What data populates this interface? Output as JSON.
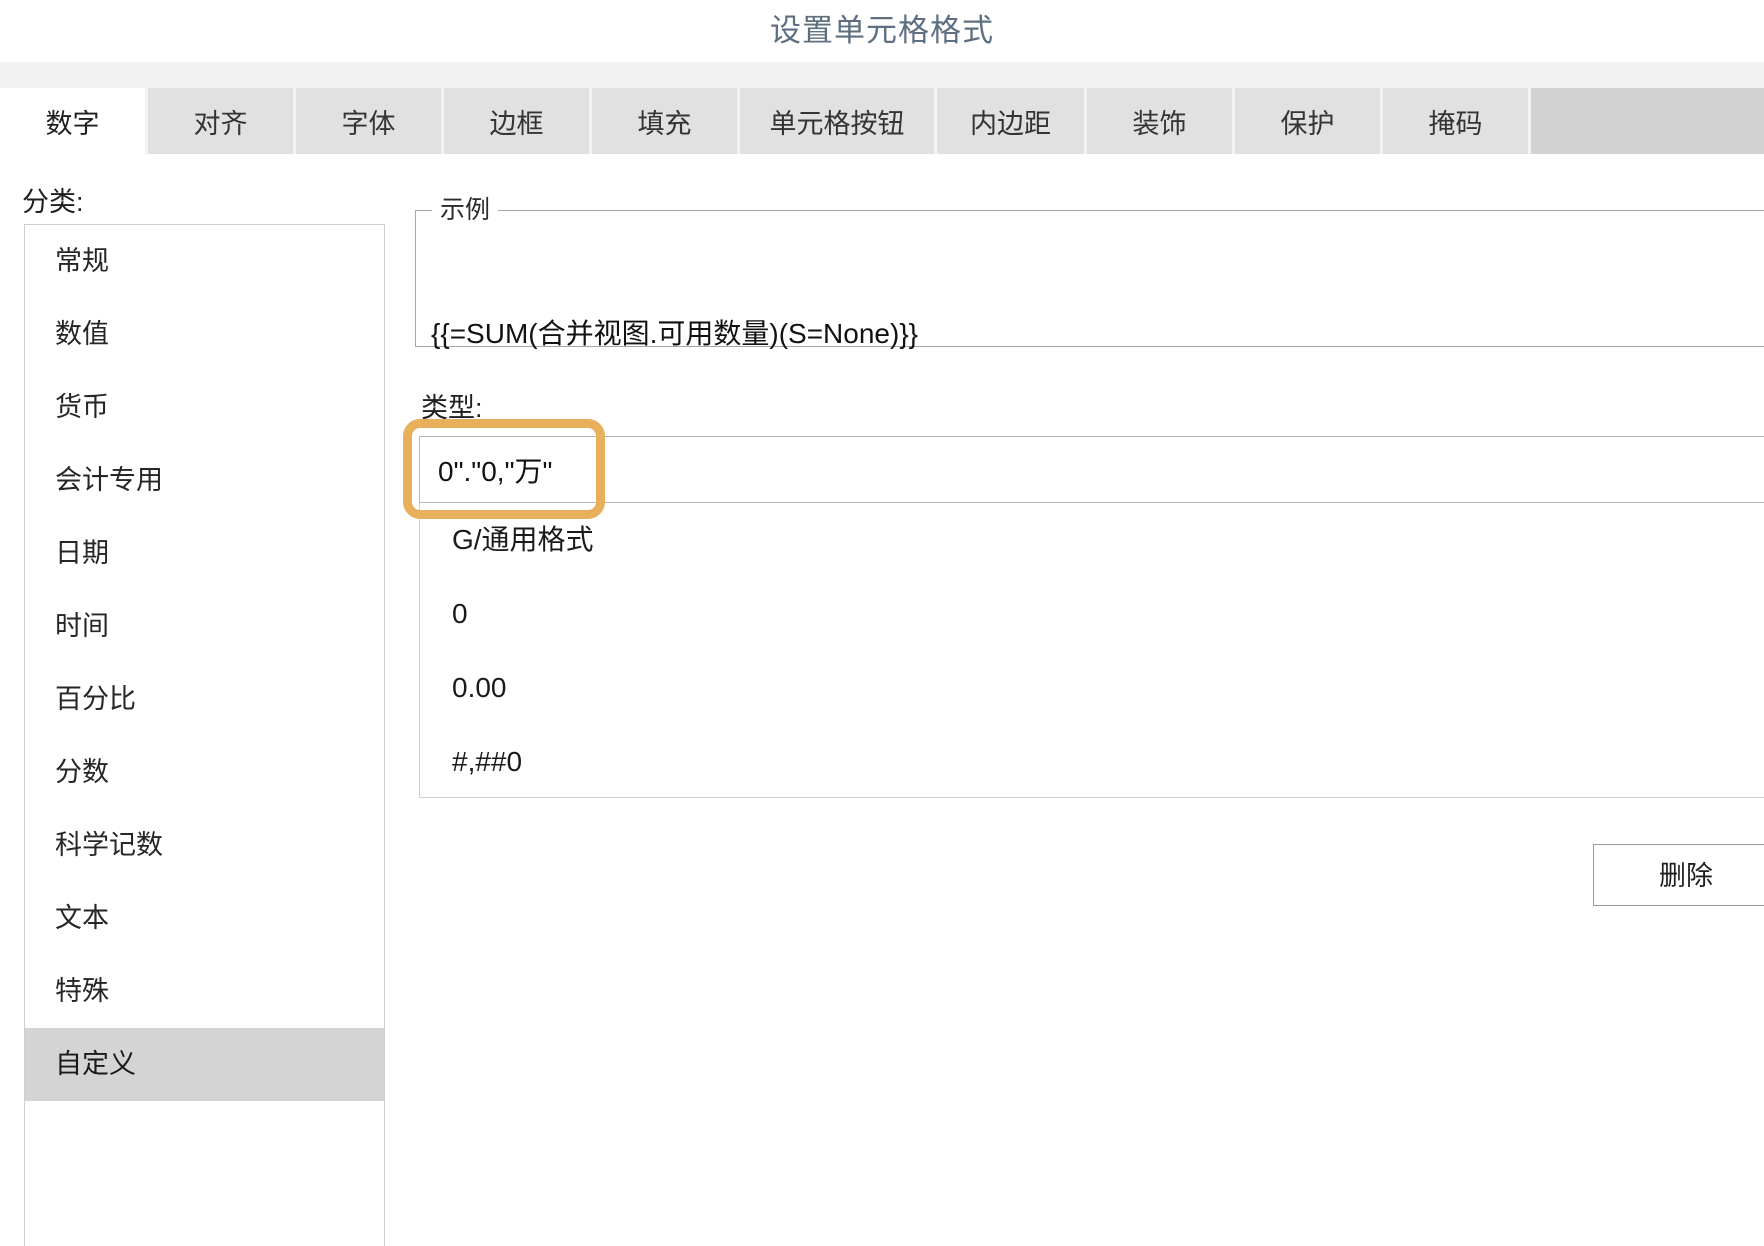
{
  "dialog": {
    "title": "设置单元格格式",
    "title_color": "#5d6f80"
  },
  "tabs": [
    {
      "label": "数字",
      "active": true
    },
    {
      "label": "对齐",
      "active": false
    },
    {
      "label": "字体",
      "active": false
    },
    {
      "label": "边框",
      "active": false
    },
    {
      "label": "填充",
      "active": false
    },
    {
      "label": "单元格按钮",
      "active": false
    },
    {
      "label": "内边距",
      "active": false
    },
    {
      "label": "装饰",
      "active": false
    },
    {
      "label": "保护",
      "active": false
    },
    {
      "label": "掩码",
      "active": false
    }
  ],
  "category": {
    "label": "分类:",
    "items": [
      {
        "label": "常规",
        "selected": false
      },
      {
        "label": "数值",
        "selected": false
      },
      {
        "label": "货币",
        "selected": false
      },
      {
        "label": "会计专用",
        "selected": false
      },
      {
        "label": "日期",
        "selected": false
      },
      {
        "label": "时间",
        "selected": false
      },
      {
        "label": "百分比",
        "selected": false
      },
      {
        "label": "分数",
        "selected": false
      },
      {
        "label": "科学记数",
        "selected": false
      },
      {
        "label": "文本",
        "selected": false
      },
      {
        "label": "特殊",
        "selected": false
      },
      {
        "label": "自定义",
        "selected": true
      }
    ]
  },
  "sample": {
    "legend": "示例",
    "value": "{{=SUM(合并视图.可用数量)(S=None)}}"
  },
  "type": {
    "label": "类型:",
    "value": "0\".\"0,\"万\"",
    "placeholder": "",
    "highlight_color": "#e8b05c",
    "options": [
      "G/通用格式",
      "0",
      "0.00",
      "#,##0"
    ]
  },
  "actions": {
    "delete_label": "删除"
  }
}
